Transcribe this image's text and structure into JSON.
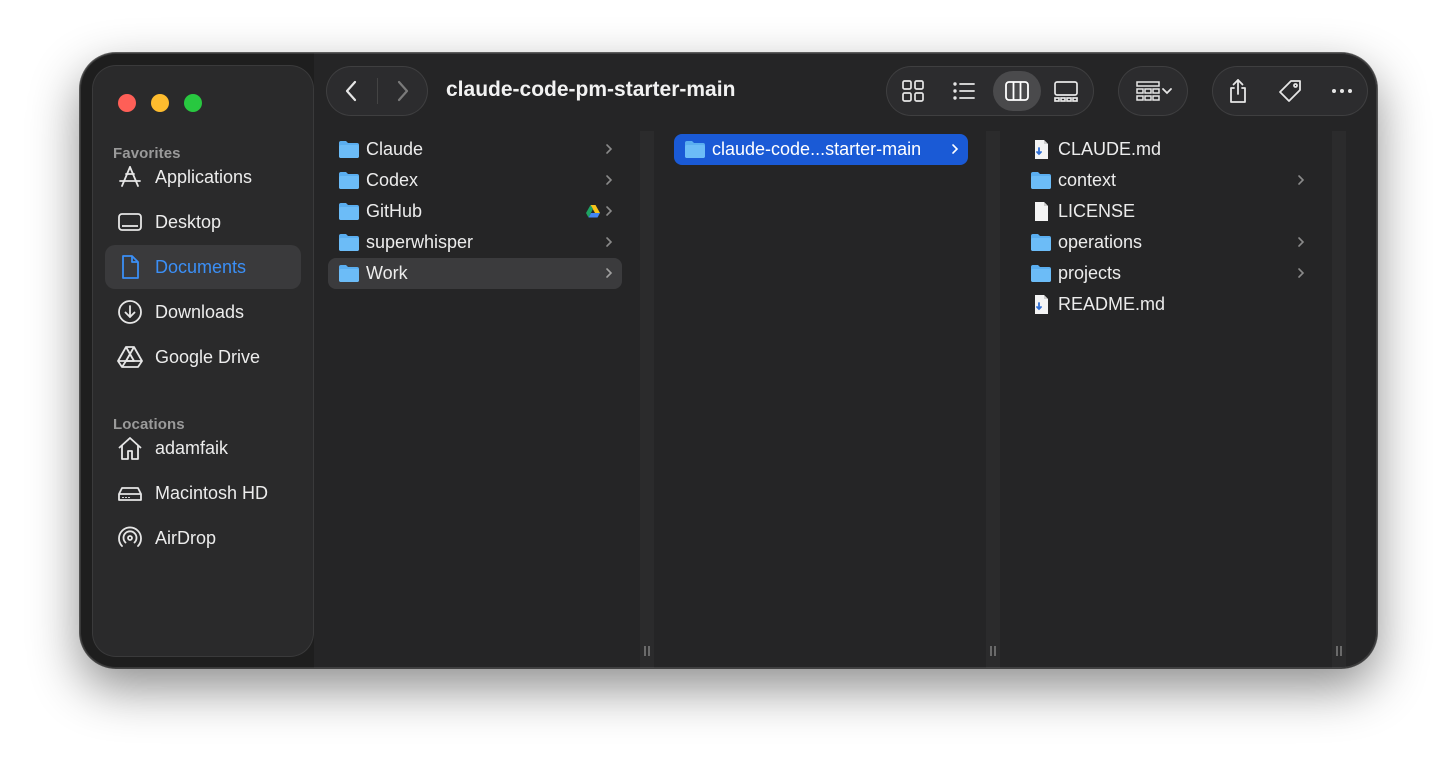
{
  "window": {
    "title": "claude-code-pm-starter-main"
  },
  "sidebar": {
    "favorites_header": "Favorites",
    "locations_header": "Locations",
    "favorites": [
      {
        "label": "Applications",
        "icon": "applications-icon"
      },
      {
        "label": "Desktop",
        "icon": "desktop-icon"
      },
      {
        "label": "Documents",
        "icon": "document-icon",
        "active": true
      },
      {
        "label": "Downloads",
        "icon": "download-icon"
      },
      {
        "label": "Google Drive",
        "icon": "google-drive-icon"
      }
    ],
    "locations": [
      {
        "label": "adamfaik",
        "icon": "home-icon"
      },
      {
        "label": "Macintosh HD",
        "icon": "hard-drive-icon"
      },
      {
        "label": "AirDrop",
        "icon": "airdrop-icon"
      }
    ]
  },
  "columns": {
    "col1": [
      {
        "name": "Claude",
        "type": "folder"
      },
      {
        "name": "Codex",
        "type": "folder"
      },
      {
        "name": "GitHub",
        "type": "folder",
        "badge": "google-drive-icon"
      },
      {
        "name": "superwhisper",
        "type": "folder"
      },
      {
        "name": "Work",
        "type": "folder",
        "selected": true
      }
    ],
    "col2": [
      {
        "name": "claude-code...starter-main",
        "type": "folder",
        "selected": true
      }
    ],
    "col3": [
      {
        "name": "CLAUDE.md",
        "type": "md"
      },
      {
        "name": "context",
        "type": "folder"
      },
      {
        "name": "LICENSE",
        "type": "file"
      },
      {
        "name": "operations",
        "type": "folder"
      },
      {
        "name": "projects",
        "type": "folder"
      },
      {
        "name": "README.md",
        "type": "md"
      }
    ]
  },
  "colors": {
    "accent": "#1a5ad6",
    "folder": "#5aaef0",
    "close": "#fe5f57",
    "minimize": "#febc2e",
    "zoom": "#28c840"
  }
}
